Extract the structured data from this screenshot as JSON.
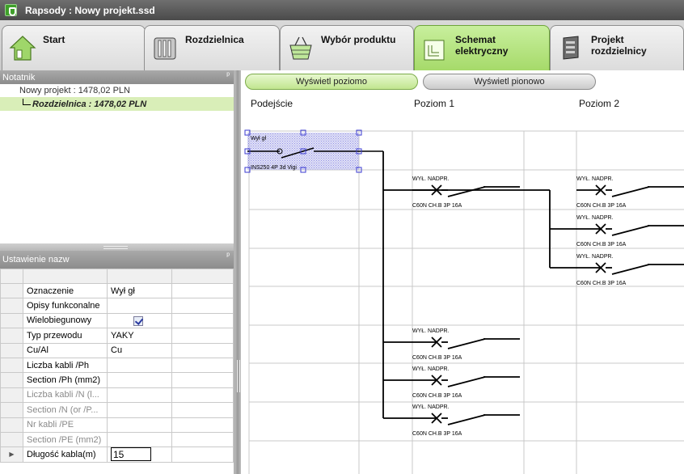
{
  "window": {
    "title": "Rapsody : Nowy projekt.ssd"
  },
  "tabs": [
    {
      "label": "Start",
      "icon": "house-icon",
      "active": false
    },
    {
      "label": "Rozdzielnica",
      "icon": "switchboard-icon",
      "active": false
    },
    {
      "label": "Wybór produktu",
      "icon": "product-basket-icon",
      "active": false
    },
    {
      "label": "Schemat\nelektryczny",
      "label_line1": "Schemat",
      "label_line2": "elektryczny",
      "icon": "schematic-icon",
      "active": true
    },
    {
      "label": "Projekt rozdzielnicy",
      "icon": "cabinet-project-icon",
      "active": false
    }
  ],
  "notatnik": {
    "title": "Notatnik",
    "root": "Nowy projekt : 1478,02 PLN",
    "child": "Rozdzielnica : 1478,02 PLN"
  },
  "properties": {
    "title": "Ustawienie nazw",
    "rows": [
      {
        "name": "Oznaczenie",
        "value": "Wył gł",
        "disabled": false
      },
      {
        "name": "Opisy funkconalne",
        "value": "",
        "disabled": false
      },
      {
        "name": "Wielobiegunowy",
        "value": "",
        "checkbox": true,
        "checked": true,
        "disabled": false
      },
      {
        "name": "Typ przewodu",
        "value": "YAKY",
        "disabled": false
      },
      {
        "name": "Cu/Al",
        "value": "Cu",
        "disabled": false
      },
      {
        "name": "Liczba kabli /Ph",
        "value": "",
        "disabled": false
      },
      {
        "name": "Section /Ph (mm2)",
        "value": "",
        "disabled": false
      },
      {
        "name": "Liczba kabli /N (l...",
        "value": "",
        "disabled": true
      },
      {
        "name": "Section /N (or /P...",
        "value": "",
        "disabled": true
      },
      {
        "name": "Nr kabli /PE",
        "value": "",
        "disabled": true
      },
      {
        "name": "Section /PE (mm2)",
        "value": "",
        "disabled": true
      },
      {
        "name": "Długość kabla(m)",
        "value": "15",
        "editing": true,
        "disabled": false
      }
    ]
  },
  "schema": {
    "view_buttons": {
      "horizontal": "Wyświetl poziomo",
      "vertical": "Wyświetl pionowo"
    },
    "columns": {
      "c0": "Podejście",
      "c1": "Poziom 1",
      "c2": "Poziom 2"
    },
    "main_switch": {
      "name": "Wył gł",
      "label": "INS250 4P 3d Vigi"
    },
    "breaker_title": "WYŁ. NADPR.",
    "breaker_ref": "C60N CH.B 3P 16A"
  },
  "colors": {
    "active_tab": "#a6da6a",
    "selection": "#3a3ad0",
    "accent_green": "#d9eeb8"
  }
}
